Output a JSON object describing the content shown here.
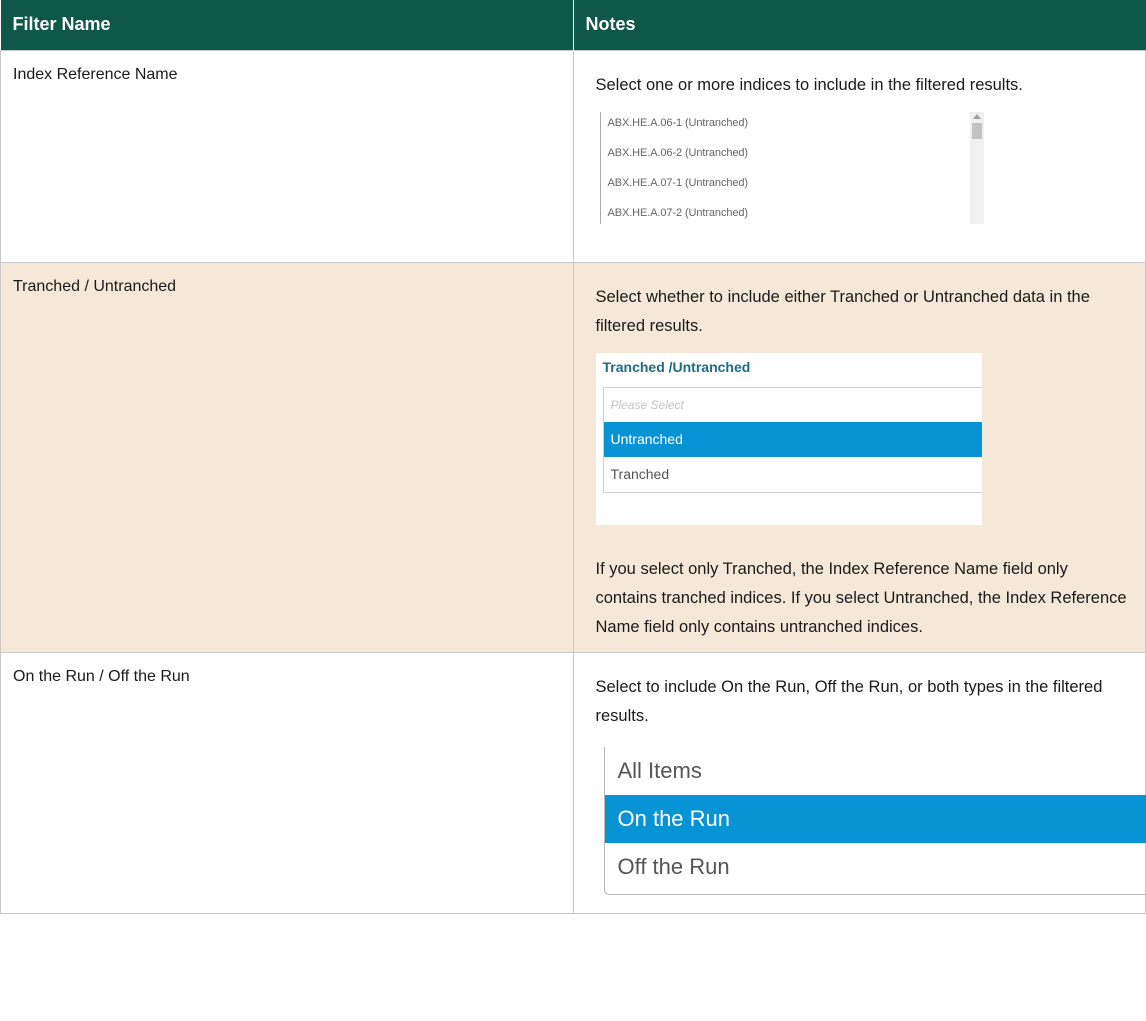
{
  "table": {
    "headers": [
      "Filter Name",
      "Notes"
    ],
    "rows": [
      {
        "name": "Index Reference Name",
        "notes": "Select one or more indices to include in the filtered results.",
        "index_list": [
          "ABX.HE.A.06-1 (Untranched)",
          "ABX.HE.A.06-2 (Untranched)",
          "ABX.HE.A.07-1 (Untranched)",
          "ABX.HE.A.07-2 (Untranched)"
        ]
      },
      {
        "name": "Tranched / Untranched",
        "notes": "Select whether to include either Tranched or Untranched data in the filtered results.",
        "dropdown": {
          "label": "Tranched /Untranched",
          "placeholder": "Please Select",
          "options": [
            "Untranched",
            "Tranched"
          ],
          "selected": "Untranched"
        },
        "notes_after": "If you select only Tranched, the Index Reference Name field only contains tranched indices. If you select Untranched, the Index Reference Name field only contains untranched indices."
      },
      {
        "name": "On the Run / Off the Run",
        "notes": "Select to include On the Run, Off the Run, or both types in the filtered results.",
        "options": [
          "All Items",
          "On the Run",
          "Off the Run"
        ],
        "selected": "On the Run"
      }
    ]
  },
  "colors": {
    "header_bg": "#0f5849",
    "shaded_row": "#f5e8d8",
    "selected_bg": "#0894d4",
    "label_blue": "#1f6a86"
  }
}
